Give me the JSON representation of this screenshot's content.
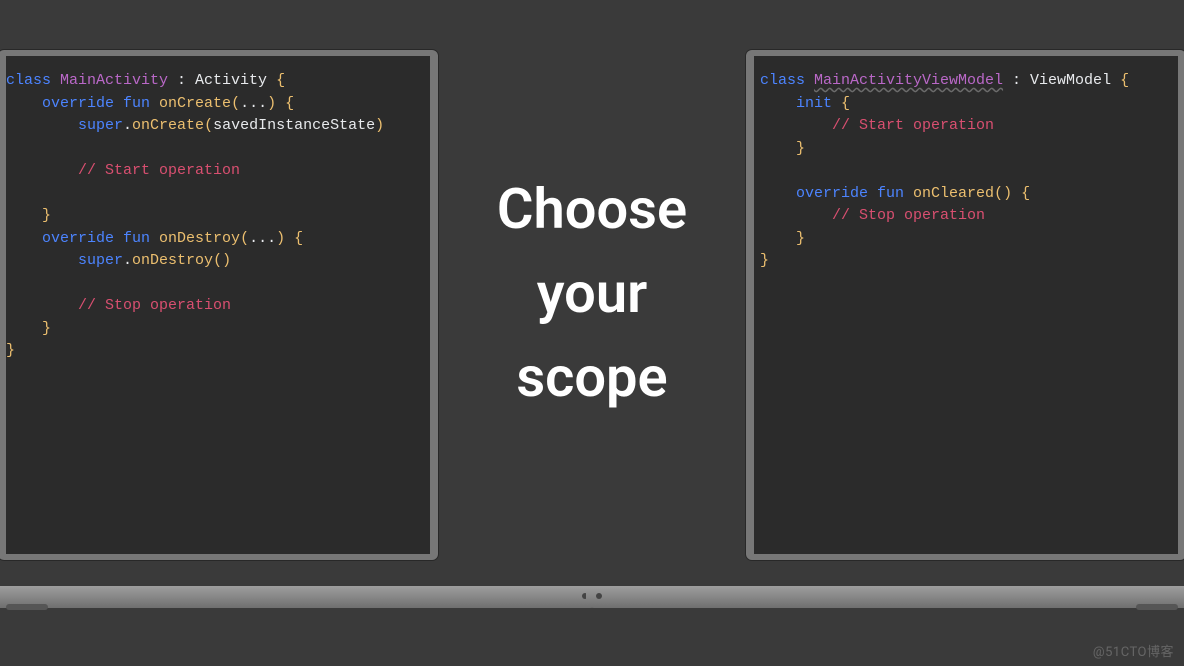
{
  "center_text": "Choose\nyour\nscope",
  "watermark": "@51CTO博客",
  "left": {
    "tokens": [
      [
        [
          "kw",
          "class "
        ],
        [
          "type",
          "MainActivity"
        ],
        [
          "id",
          " : Activity "
        ],
        [
          "brace",
          "{"
        ]
      ],
      [
        [
          "id",
          "    "
        ],
        [
          "kw",
          "override fun "
        ],
        [
          "fn",
          "onCreate"
        ],
        [
          "par",
          "("
        ],
        [
          "id",
          "..."
        ],
        [
          "par",
          ") "
        ],
        [
          "brace",
          "{"
        ]
      ],
      [
        [
          "id",
          "        "
        ],
        [
          "kw",
          "super"
        ],
        [
          "id",
          "."
        ],
        [
          "fn",
          "onCreate"
        ],
        [
          "par",
          "("
        ],
        [
          "id",
          "savedInstanceState"
        ],
        [
          "par",
          ")"
        ]
      ],
      [
        [
          "id",
          ""
        ]
      ],
      [
        [
          "id",
          "        "
        ],
        [
          "cmt",
          "// Start operation"
        ]
      ],
      [
        [
          "id",
          ""
        ]
      ],
      [
        [
          "id",
          "    "
        ],
        [
          "brace",
          "}"
        ]
      ],
      [
        [
          "id",
          "    "
        ],
        [
          "kw",
          "override fun "
        ],
        [
          "fn",
          "onDestroy"
        ],
        [
          "par",
          "("
        ],
        [
          "id",
          "..."
        ],
        [
          "par",
          ") "
        ],
        [
          "brace",
          "{"
        ]
      ],
      [
        [
          "id",
          "        "
        ],
        [
          "kw",
          "super"
        ],
        [
          "id",
          "."
        ],
        [
          "fn",
          "onDestroy"
        ],
        [
          "par",
          "("
        ],
        [
          "par",
          ")"
        ]
      ],
      [
        [
          "id",
          ""
        ]
      ],
      [
        [
          "id",
          "        "
        ],
        [
          "cmt",
          "// Stop operation"
        ]
      ],
      [
        [
          "id",
          "    "
        ],
        [
          "brace",
          "}"
        ]
      ],
      [
        [
          "brace",
          "}"
        ]
      ]
    ]
  },
  "right": {
    "tokens": [
      [
        [
          "kw",
          "class "
        ],
        [
          "type2",
          "MainActivityViewModel"
        ],
        [
          "id",
          " : ViewModel "
        ],
        [
          "brace",
          "{"
        ]
      ],
      [
        [
          "id",
          "    "
        ],
        [
          "kw",
          "init "
        ],
        [
          "brace",
          "{"
        ]
      ],
      [
        [
          "id",
          "        "
        ],
        [
          "cmt",
          "// Start operation"
        ]
      ],
      [
        [
          "id",
          "    "
        ],
        [
          "brace",
          "}"
        ]
      ],
      [
        [
          "id",
          ""
        ]
      ],
      [
        [
          "id",
          "    "
        ],
        [
          "kw",
          "override fun "
        ],
        [
          "fn",
          "onCleared"
        ],
        [
          "par",
          "("
        ],
        [
          "par",
          ") "
        ],
        [
          "brace",
          "{"
        ]
      ],
      [
        [
          "id",
          "        "
        ],
        [
          "cmt",
          "// Stop operation"
        ]
      ],
      [
        [
          "id",
          "    "
        ],
        [
          "brace",
          "}"
        ]
      ],
      [
        [
          "brace",
          "}"
        ]
      ]
    ]
  }
}
